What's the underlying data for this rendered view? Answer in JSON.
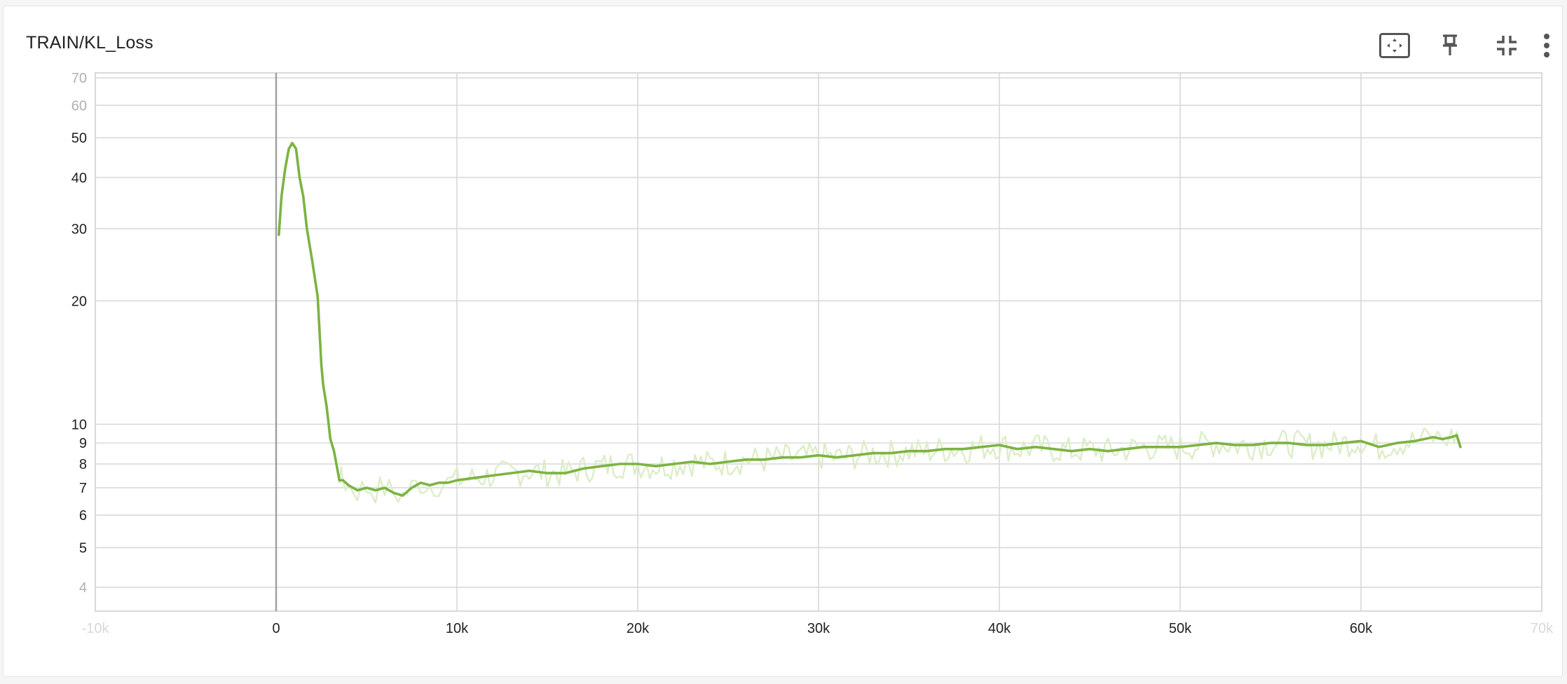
{
  "card": {
    "title": "TRAIN/KL_Loss",
    "toolbar": [
      {
        "name": "fit-domain-button",
        "icon": "fit-to-data-icon"
      },
      {
        "name": "pin-button",
        "icon": "pin-icon"
      },
      {
        "name": "collapse-button",
        "icon": "collapse-icon"
      },
      {
        "name": "more-menu-button",
        "icon": "more-vert-icon"
      }
    ]
  },
  "colors": {
    "smoothed": "#7cb342",
    "raw": "#dcedc8",
    "grid": "#d9d9d9",
    "zero_line": "#9e9e9e"
  },
  "chart_data": {
    "type": "line",
    "title": "TRAIN/KL_Loss",
    "xlabel": "",
    "ylabel": "",
    "y_scale": "log",
    "xlim": [
      -10000,
      70000
    ],
    "ylim": [
      3.5,
      72
    ],
    "grid": true,
    "x_ticks": [
      {
        "value": -10000,
        "label": "-10k",
        "faded": true
      },
      {
        "value": 0,
        "label": "0",
        "faded": false
      },
      {
        "value": 10000,
        "label": "10k",
        "faded": false
      },
      {
        "value": 20000,
        "label": "20k",
        "faded": false
      },
      {
        "value": 30000,
        "label": "30k",
        "faded": false
      },
      {
        "value": 40000,
        "label": "40k",
        "faded": false
      },
      {
        "value": 50000,
        "label": "50k",
        "faded": false
      },
      {
        "value": 60000,
        "label": "60k",
        "faded": false
      },
      {
        "value": 70000,
        "label": "70k",
        "faded": true
      }
    ],
    "y_ticks": [
      {
        "value": 4,
        "label": "4",
        "faded": true
      },
      {
        "value": 5,
        "label": "5",
        "faded": false
      },
      {
        "value": 6,
        "label": "6",
        "faded": false
      },
      {
        "value": 7,
        "label": "7",
        "faded": false
      },
      {
        "value": 8,
        "label": "8",
        "faded": false
      },
      {
        "value": 9,
        "label": "9",
        "faded": false
      },
      {
        "value": 10,
        "label": "10",
        "faded": false
      },
      {
        "value": 20,
        "label": "20",
        "faded": false
      },
      {
        "value": 30,
        "label": "30",
        "faded": false
      },
      {
        "value": 40,
        "label": "40",
        "faded": false
      },
      {
        "value": 50,
        "label": "50",
        "faded": false
      },
      {
        "value": 60,
        "label": "60",
        "faded": true
      },
      {
        "value": 70,
        "label": "70",
        "faded": true
      }
    ],
    "series": [
      {
        "kind": "smoothed",
        "x": [
          150,
          300,
          500,
          700,
          900,
          1100,
          1300,
          1500,
          1700,
          2000,
          2300,
          2500,
          2600,
          2800,
          3000,
          3200,
          3500,
          3700,
          4000,
          4500,
          5000,
          5500,
          6000,
          6500,
          7000,
          7500,
          8000,
          8500,
          9000,
          9500,
          10000,
          11000,
          12000,
          13000,
          14000,
          15000,
          16000,
          17000,
          18000,
          19000,
          20000,
          21000,
          22000,
          23000,
          24000,
          25000,
          26000,
          27000,
          28000,
          29000,
          30000,
          31000,
          32000,
          33000,
          34000,
          35000,
          36000,
          37000,
          38000,
          39000,
          40000,
          41000,
          42000,
          43000,
          44000,
          45000,
          46000,
          47000,
          48000,
          49000,
          50000,
          51000,
          52000,
          53000,
          54000,
          55000,
          56000,
          57000,
          58000,
          59000,
          60000,
          61000,
          62000,
          63000,
          63500,
          64000,
          64500,
          65000,
          65300,
          65500
        ],
        "y": [
          29,
          36,
          42,
          47,
          48.5,
          47,
          40,
          36,
          30,
          25,
          20.5,
          14,
          12.5,
          11,
          9.2,
          8.6,
          7.3,
          7.3,
          7.1,
          6.9,
          7.0,
          6.9,
          7.0,
          6.8,
          6.7,
          7.0,
          7.2,
          7.1,
          7.2,
          7.2,
          7.3,
          7.4,
          7.5,
          7.6,
          7.7,
          7.6,
          7.6,
          7.8,
          7.9,
          8.0,
          8.0,
          7.9,
          8.0,
          8.1,
          8.0,
          8.1,
          8.2,
          8.2,
          8.3,
          8.3,
          8.4,
          8.3,
          8.4,
          8.5,
          8.5,
          8.6,
          8.6,
          8.7,
          8.7,
          8.8,
          8.9,
          8.7,
          8.8,
          8.7,
          8.6,
          8.7,
          8.6,
          8.7,
          8.8,
          8.8,
          8.8,
          8.9,
          9.0,
          8.9,
          8.9,
          9.0,
          9.0,
          8.9,
          8.9,
          9.0,
          9.1,
          8.8,
          9.0,
          9.1,
          9.2,
          9.3,
          9.2,
          9.3,
          9.4,
          8.8
        ]
      }
    ]
  }
}
